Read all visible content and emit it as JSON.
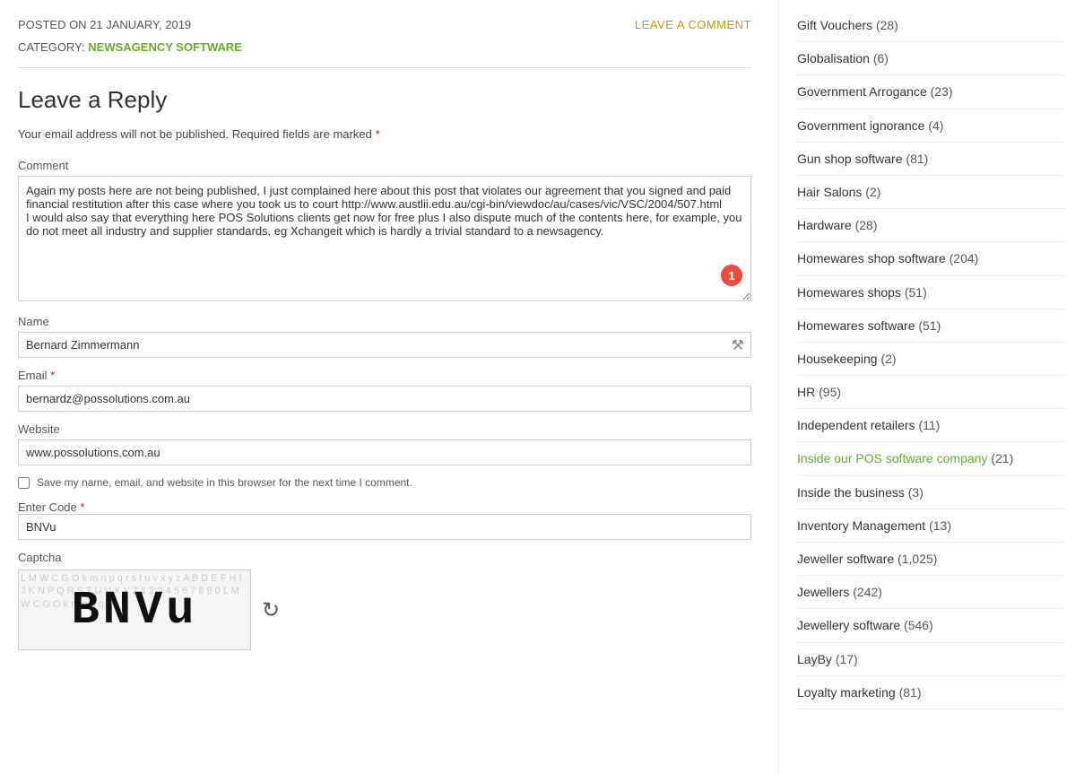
{
  "post": {
    "date": "POSTED ON 21 JANUARY, 2019",
    "leave_comment": "LEAVE A COMMENT",
    "category_label": "CATEGORY:",
    "category_link": "NEWSAGENCY SOFTWARE",
    "reply_title": "Leave a Reply",
    "email_notice": "Your email address will not be published.",
    "required_notice": "Required fields are marked",
    "comment_label": "Comment",
    "comment_value": "Again my posts here are not being published, I just complained here about this post that violates our agreement that you signed and paid financial restitution after this case where you took us to court http://www.austlii.edu.au/cgi-bin/viewdoc/au/cases/vic/VSC/2004/507.html\nI would also say that everything here POS Solutions clients get now for free plus I also dispute much of the contents here, for example, you do not meet all industry and supplier standards, eg Xchangeit which is hardly a trivial standard to a newsagency.",
    "comment_badge": "1",
    "name_label": "Name",
    "name_value": "Bernard Zimmermann",
    "email_label": "Email",
    "email_required": true,
    "email_value": "bernardz@possolutions.com.au",
    "website_label": "Website",
    "website_value": "www.possolutions.com.au",
    "save_checkbox_label": "Save my name, email, and website in this browser for the next time I comment.",
    "enter_code_label": "Enter Code",
    "enter_code_value": "BNVu",
    "captcha_label": "Captcha",
    "captcha_text": "BNVu",
    "captcha_noise": "L M W C G O k m n p q r s t u v x y z A B D E F H I J K N P Q R S T U V X Y Z"
  },
  "sidebar": {
    "items": [
      {
        "label": "Gift Vouchers",
        "count": "(28)",
        "active": false
      },
      {
        "label": "Globalisation",
        "count": "(6)",
        "active": false
      },
      {
        "label": "Government Arrogance",
        "count": "(23)",
        "active": false
      },
      {
        "label": "Government ignorance",
        "count": "(4)",
        "active": false
      },
      {
        "label": "Gun shop software",
        "count": "(81)",
        "active": false
      },
      {
        "label": "Hair Salons",
        "count": "(2)",
        "active": false
      },
      {
        "label": "Hardware",
        "count": "(28)",
        "active": false
      },
      {
        "label": "Homewares shop software",
        "count": "(204)",
        "active": false
      },
      {
        "label": "Homewares shops",
        "count": "(51)",
        "active": false
      },
      {
        "label": "Homewares software",
        "count": "(51)",
        "active": false
      },
      {
        "label": "Housekeeping",
        "count": "(2)",
        "active": false
      },
      {
        "label": "HR",
        "count": "(95)",
        "active": false
      },
      {
        "label": "Independent retailers",
        "count": "(11)",
        "active": false
      },
      {
        "label": "Inside our POS software company",
        "count": "(21)",
        "active": true
      },
      {
        "label": "Inside the business",
        "count": "(3)",
        "active": false
      },
      {
        "label": "Inventory Management",
        "count": "(13)",
        "active": false
      },
      {
        "label": "Jeweller software",
        "count": "(1,025)",
        "active": false
      },
      {
        "label": "Jewellers",
        "count": "(242)",
        "active": false
      },
      {
        "label": "Jewellery software",
        "count": "(546)",
        "active": false
      },
      {
        "label": "LayBy",
        "count": "(17)",
        "active": false
      },
      {
        "label": "Loyalty marketing",
        "count": "(81)",
        "active": false
      }
    ]
  }
}
